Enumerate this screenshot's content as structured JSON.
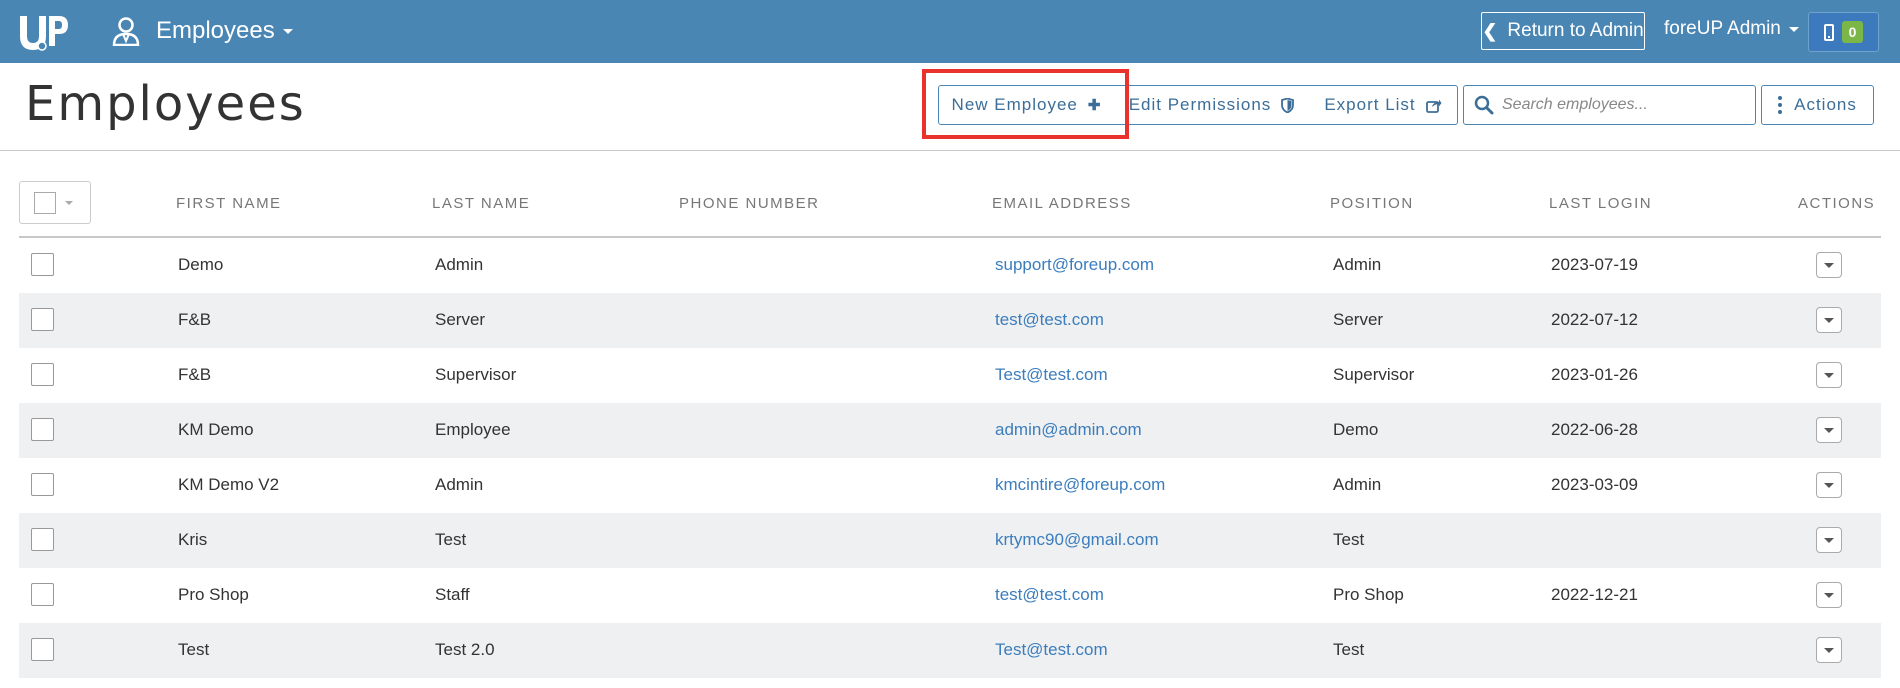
{
  "header": {
    "section_label": "Employees",
    "return_label": "Return to Admin",
    "user_menu": "foreUP Admin",
    "notification_count": "0"
  },
  "page": {
    "title": "Employees"
  },
  "toolbar": {
    "new_label": "New Employee",
    "permissions_label": "Edit Permissions",
    "export_label": "Export List",
    "search_placeholder": "Search employees...",
    "actions_label": "Actions"
  },
  "table": {
    "columns": [
      "FIRST NAME",
      "LAST NAME",
      "PHONE NUMBER",
      "EMAIL ADDRESS",
      "POSITION",
      "LAST LOGIN",
      "ACTIONS"
    ],
    "rows": [
      {
        "first": "Demo",
        "last": "Admin",
        "phone": "",
        "email": "support@foreup.com",
        "position": "Admin",
        "login": "2023-07-19"
      },
      {
        "first": "F&B",
        "last": "Server",
        "phone": "",
        "email": "test@test.com",
        "position": "Server",
        "login": "2022-07-12"
      },
      {
        "first": "F&B",
        "last": "Supervisor",
        "phone": "",
        "email": "Test@test.com",
        "position": "Supervisor",
        "login": "2023-01-26"
      },
      {
        "first": "KM Demo",
        "last": "Employee",
        "phone": "",
        "email": "admin@admin.com",
        "position": "Demo",
        "login": "2022-06-28"
      },
      {
        "first": "KM Demo V2",
        "last": "Admin",
        "phone": "",
        "email": "kmcintire@foreup.com",
        "position": "Admin",
        "login": "2023-03-09"
      },
      {
        "first": "Kris",
        "last": "Test",
        "phone": "",
        "email": "krtymc90@gmail.com",
        "position": "Test",
        "login": ""
      },
      {
        "first": "Pro Shop",
        "last": "Staff",
        "phone": "",
        "email": "test@test.com",
        "position": "Pro Shop",
        "login": "2022-12-21"
      },
      {
        "first": "Test",
        "last": "Test 2.0",
        "phone": "",
        "email": "Test@test.com",
        "position": "Test",
        "login": ""
      }
    ]
  },
  "colors": {
    "header_bg": "#4a86b4",
    "link": "#3c7dbd",
    "highlight": "#e8322b",
    "badge": "#7ab648"
  }
}
